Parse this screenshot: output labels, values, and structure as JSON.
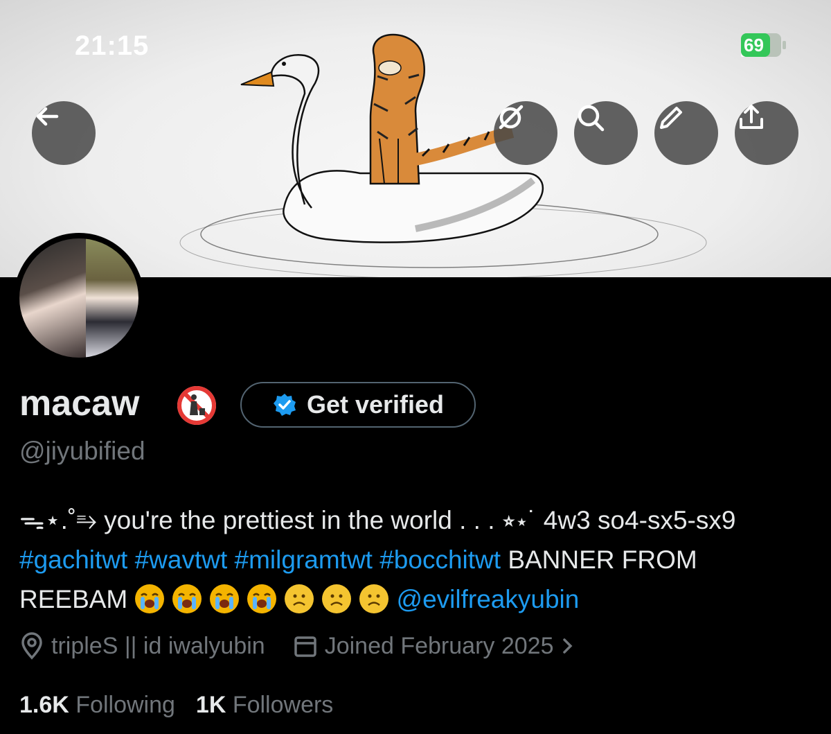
{
  "status_bar": {
    "time": "21:15",
    "battery": "69"
  },
  "header": {
    "back_icon": "arrow-left-icon",
    "grok_icon": "grok-icon",
    "search_icon": "search-icon",
    "edit_icon": "pencil-icon",
    "share_icon": "share-icon"
  },
  "profile": {
    "display_name": "macaw",
    "name_emoji": "🚯",
    "verify_label": "Get verified",
    "handle": "@jiyubified",
    "bio": {
      "prefix": "ᯓ⋆.˚⥱ you're the prettiest in the world . . . ⭒⋆˙ 4w3 so4-sx5-sx9 ",
      "tags": [
        "#gachitwt",
        "#wavtwt",
        "#milgramtwt",
        "#bocchitwt"
      ],
      "middle": " BANNER FROM REEBAM ",
      "mention": "@evilfreakyubin"
    },
    "location": "tripleS || id iwalyubin",
    "joined": "Joined February 2025",
    "following_count": "1.6K",
    "following_label": "Following",
    "followers_count": "1K",
    "followers_label": "Followers"
  },
  "colors": {
    "link": "#1d9bf0",
    "verified": "#1d9bf0",
    "text": "#e7e9ea",
    "muted": "#71767b"
  }
}
